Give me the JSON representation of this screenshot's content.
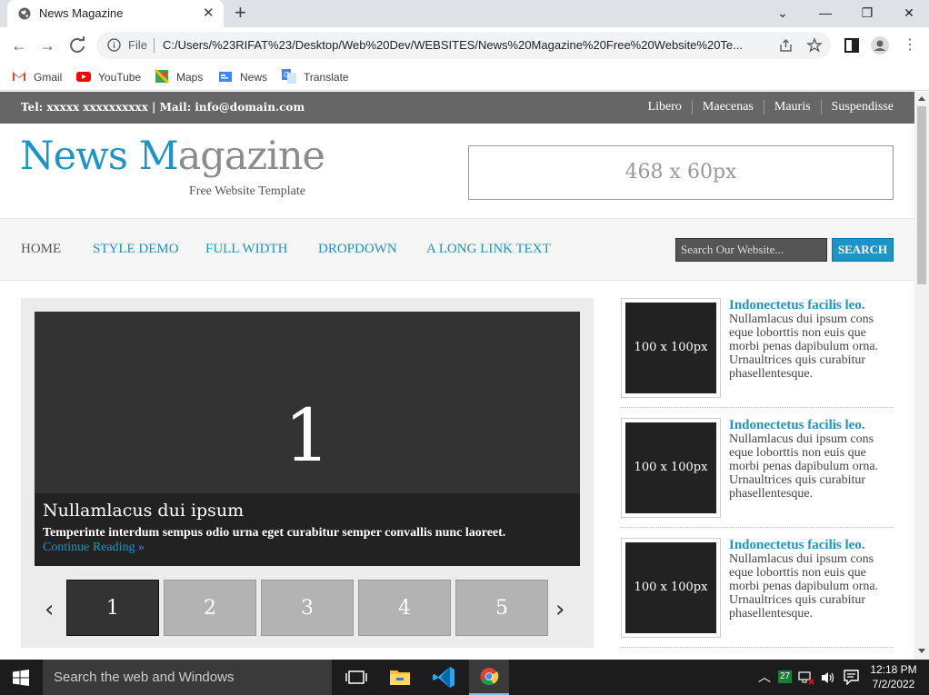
{
  "browser": {
    "tab_title": "News Magazine",
    "tab_close": "✕",
    "new_tab": "+",
    "window_controls": {
      "minimize": "—",
      "restore": "❐",
      "close": "✕",
      "dropdown": "⌄"
    },
    "address_scheme": "File",
    "address_url": "C:/Users/%23RIFAT%23/Desktop/Web%20Dev/WEBSITES/News%20Magazine%20Free%20Website%20Te...",
    "bookmarks": [
      "Gmail",
      "YouTube",
      "Maps",
      "News",
      "Translate"
    ]
  },
  "site": {
    "contact": "Tel: xxxxx xxxxxxxxxx | Mail: info@domain.com",
    "top_links": [
      "Libero",
      "Maecenas",
      "Mauris",
      "Suspendisse"
    ],
    "logo_part1": "News M",
    "logo_part2": "agazine",
    "logo_sub": "Free Website Template",
    "banner": "468 x 60px",
    "nav": [
      "HOME",
      "STYLE DEMO",
      "FULL WIDTH",
      "DROPDOWN",
      "A LONG LINK TEXT"
    ],
    "search_placeholder": "Search Our Website...",
    "search_button": "SEARCH",
    "slider": {
      "slide_number": "1",
      "caption_title": "Nullamlacus dui ipsum",
      "caption_text": "Temperinte interdum sempus odio urna eget curabitur semper convallis nunc laoreet.",
      "caption_link": "Continue Reading »",
      "thumbs": [
        "1",
        "2",
        "3",
        "4",
        "5"
      ],
      "prev": "‹",
      "next": "›"
    },
    "posts": [
      {
        "image": "100 x 100px",
        "title": "Indonectetus facilis leo.",
        "text": "Nullamlacus dui ipsum cons eque loborttis non euis que morbi penas dapibulum orna. Urnaultrices quis curabitur phasellentesque."
      },
      {
        "image": "100 x 100px",
        "title": "Indonectetus facilis leo.",
        "text": "Nullamlacus dui ipsum cons eque loborttis non euis que morbi penas dapibulum orna. Urnaultrices quis curabitur phasellentesque."
      },
      {
        "image": "100 x 100px",
        "title": "Indonectetus facilis leo.",
        "text": "Nullamlacus dui ipsum cons eque loborttis non euis que morbi penas dapibulum orna. Urnaultrices quis curabitur phasellentesque."
      }
    ]
  },
  "taskbar": {
    "search_placeholder": "Search the web and Windows",
    "badge": "27",
    "time": "12:18 PM",
    "date": "7/2/2022"
  },
  "colors": {
    "accent": "#1d94c8",
    "topbar": "#666666",
    "taskbar": "#1c1c1c"
  }
}
